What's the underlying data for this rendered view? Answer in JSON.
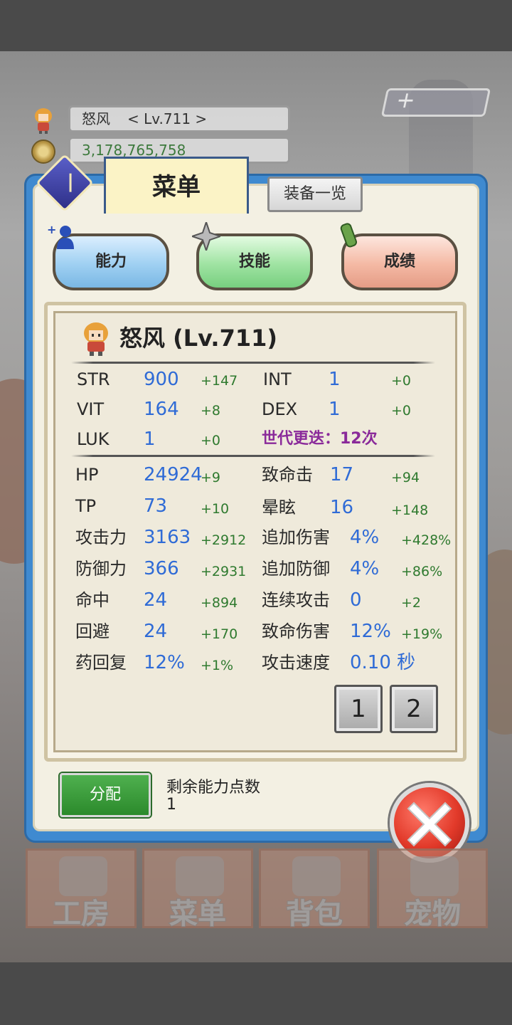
{
  "hud": {
    "player_name": "怒风",
    "player_level": "< Lv.711 >",
    "gold": "3,178,765,758",
    "plus_button_text": "＋"
  },
  "panel": {
    "title": "菜单",
    "equip_list_button": "装备一览",
    "tabs": [
      {
        "label": "能力"
      },
      {
        "label": "技能"
      },
      {
        "label": "成绩"
      }
    ]
  },
  "stats_header": "怒风 (Lv.711)",
  "base_stats": [
    {
      "label": "STR",
      "value": "900",
      "bonus": "+147"
    },
    {
      "label": "INT",
      "value": "1",
      "bonus": "+0"
    },
    {
      "label": "VIT",
      "value": "164",
      "bonus": "+8"
    },
    {
      "label": "DEX",
      "value": "1",
      "bonus": "+0"
    },
    {
      "label": "LUK",
      "value": "1",
      "bonus": "+0"
    }
  ],
  "generation": "世代更迭：12次",
  "combat_stats": [
    {
      "label": "HP",
      "value": "24924",
      "bonus": "+9"
    },
    {
      "label": "致命击",
      "value": "17",
      "bonus": "+94"
    },
    {
      "label": "TP",
      "value": "73",
      "bonus": "+10"
    },
    {
      "label": "晕眩",
      "value": "16",
      "bonus": "+148"
    },
    {
      "label": "攻击力",
      "value": "3163",
      "bonus": "+2912"
    },
    {
      "label": "追加伤害",
      "value": "4%",
      "bonus": "+428%"
    },
    {
      "label": "防御力",
      "value": "366",
      "bonus": "+2931"
    },
    {
      "label": "追加防御",
      "value": "4%",
      "bonus": "+86%"
    },
    {
      "label": "命中",
      "value": "24",
      "bonus": "+894"
    },
    {
      "label": "连续攻击",
      "value": "0",
      "bonus": "+2"
    },
    {
      "label": "回避",
      "value": "24",
      "bonus": "+170"
    },
    {
      "label": "致命伤害",
      "value": "12%",
      "bonus": "+19%"
    },
    {
      "label": "药回复",
      "value": "12%",
      "bonus": "+1%"
    },
    {
      "label": "攻击速度",
      "value": "0.10 秒",
      "bonus": ""
    }
  ],
  "page_buttons": [
    "1",
    "2"
  ],
  "assign_button": "分配",
  "remaining_points_label": "剩余能力点数",
  "remaining_points_value": "1",
  "nav": [
    {
      "label": "工房",
      "icon": "workshop-icon"
    },
    {
      "label": "菜单",
      "icon": "menu-book-icon"
    },
    {
      "label": "背包",
      "icon": "backpack-icon"
    },
    {
      "label": "宠物",
      "icon": "pet-icon"
    }
  ],
  "colors": {
    "panel_blue": "#3f8ad0",
    "stat_value": "#2f6bd6",
    "stat_bonus": "#2f7a2f",
    "generation": "#8a2a9a"
  }
}
